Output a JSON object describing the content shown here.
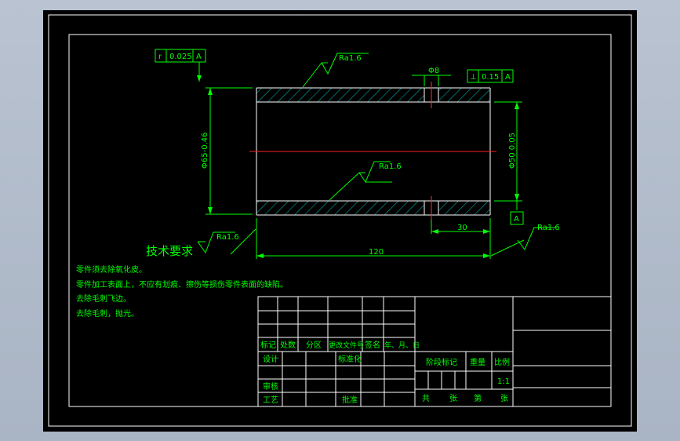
{
  "colors": {
    "background": "#000000",
    "outline": "#ffffff",
    "text": "#00ff00",
    "centerline": "#ff0000"
  },
  "drawing": {
    "roundness_tolerance": {
      "symbol": "r",
      "value": "0.025",
      "datum": "A"
    },
    "perpendicularity_tolerance": {
      "symbol": "⊥",
      "value": "0.15",
      "datum": "A"
    },
    "roughness_top": "Ra1.6",
    "roughness_inner": "Ra1.6",
    "roughness_left": "Ra1.6",
    "roughness_right": "Ra1.6",
    "hole_dim": "Φ8",
    "outer_dia": "Φ65-0.46",
    "inner_dia": "Φ50 0.05",
    "datum_label": "A",
    "length": "120",
    "hole_pos": "30"
  },
  "tech_requirements": {
    "title": "技术要求",
    "items": [
      "零件须去除氧化皮。",
      "零件加工表面上，不应有划痕、擦伤等损伤零件表面的缺陷。",
      "去除毛刺飞边。",
      "去除毛刺，抛光。"
    ]
  },
  "title_block": {
    "row_labels": [
      "标记",
      "处数",
      "分区",
      "更改文件号",
      "签名",
      "年、月、日"
    ],
    "design": "设计",
    "standardize": "标准化",
    "review": "审核",
    "process": "工艺",
    "approve": "批准",
    "stage_mark": "阶段标记",
    "weight": "重量",
    "scale": "比例",
    "scale_value": "1:1",
    "total": "共",
    "sheet": "张",
    "num": "第",
    "page": "张"
  }
}
